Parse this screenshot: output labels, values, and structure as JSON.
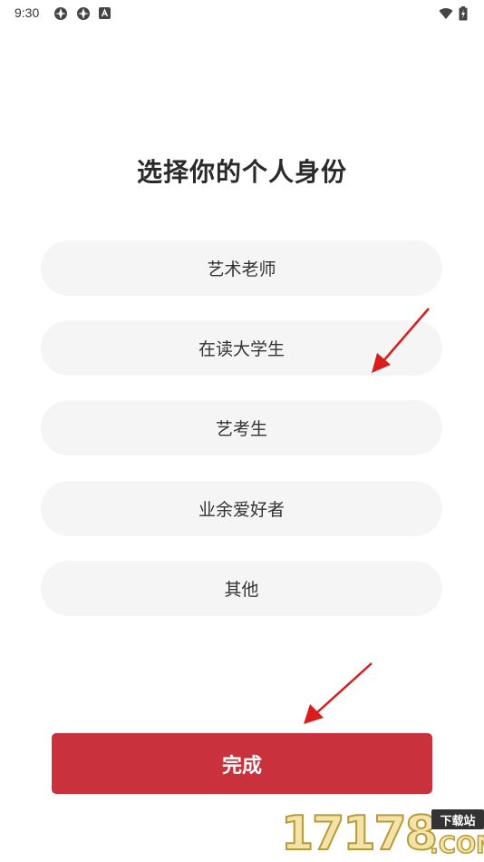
{
  "status_bar": {
    "time": "9:30",
    "icons": [
      "app-notification-icon",
      "app-notification-icon",
      "a-notification-icon",
      "wifi-icon",
      "battery-charging-icon"
    ]
  },
  "page": {
    "title": "选择你的个人身份"
  },
  "options": [
    {
      "label": "艺术老师"
    },
    {
      "label": "在读大学生"
    },
    {
      "label": "艺考生"
    },
    {
      "label": "业余爱好者"
    },
    {
      "label": "其他"
    }
  ],
  "actions": {
    "done_label": "完成"
  },
  "annotations": {
    "arrow_color": "#d91c1c"
  },
  "watermark": {
    "number": "17178",
    "tag": "下载站",
    "suffix": ".COM"
  },
  "colors": {
    "primary": "#c9323d",
    "option_bg": "#f5f5f5"
  }
}
